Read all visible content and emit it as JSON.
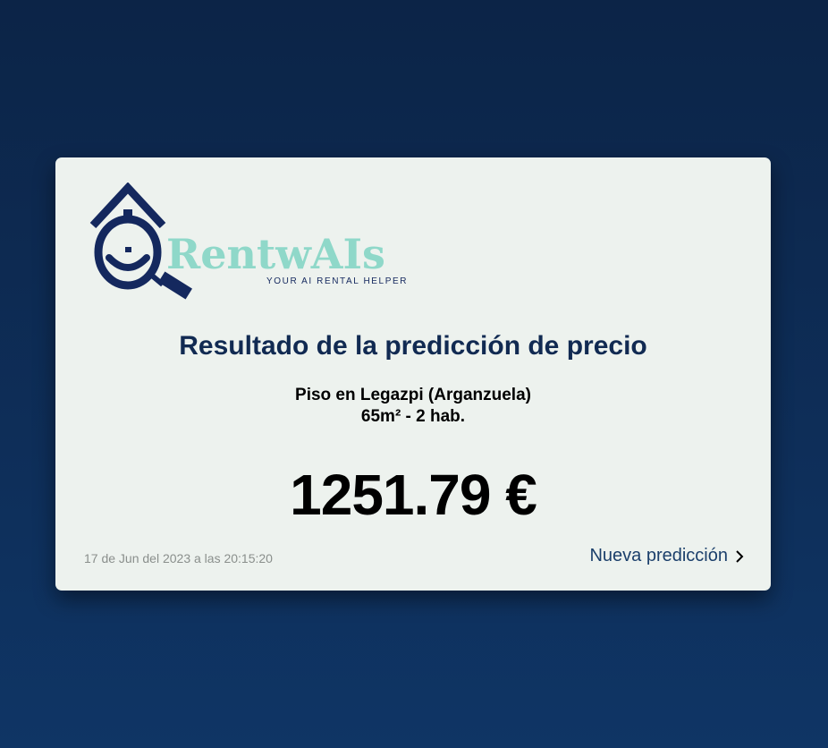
{
  "logo": {
    "wordmark": "RentwAIs",
    "tagline": "YOUR AI RENTAL HELPER"
  },
  "result": {
    "title": "Resultado de la predicción de precio",
    "property_line": "Piso en Legazpi (Arganzuela)",
    "details_line": "65m² - 2 hab.",
    "price": "1251.79 €",
    "timestamp": "17 de Jun del 2023 a las 20:15:20"
  },
  "actions": {
    "new_prediction_label": "Nueva predicción"
  },
  "colors": {
    "background_top": "#0c2447",
    "background_bottom": "#0f3565",
    "card": "#edf2ee",
    "brand_navy": "#14285e",
    "brand_mint": "#8fd8c9",
    "title": "#112a52",
    "link": "#1b3f6b"
  }
}
